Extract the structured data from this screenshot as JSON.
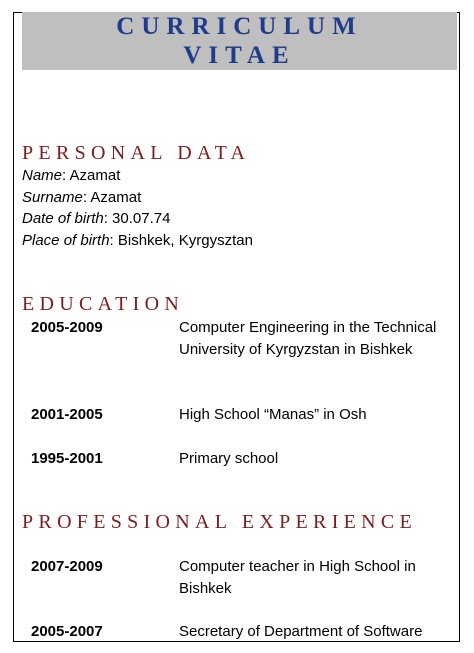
{
  "title": {
    "line1": "CURRICULUM",
    "line2": "VITAE"
  },
  "colors": {
    "title": "#1f3c8a",
    "section_heading": "#7b1d1d",
    "banner": "#bfbfbf"
  },
  "personal_data": {
    "heading": "PERSONAL DATA",
    "fields": [
      {
        "label": "Name",
        "value": ": Azamat"
      },
      {
        "label": "Surname",
        "value": ": Azamat"
      },
      {
        "label": "Date of birth",
        "value": ": 30.07.74"
      },
      {
        "label": "Place of birth",
        "value": ": Bishkek, Kyrgysztan"
      }
    ]
  },
  "education": {
    "heading": "EDUCATION",
    "entries": [
      {
        "years": "2005-2009",
        "description": "Computer Engineering in the Technical University of Kyrgyzstan in Bishkek"
      },
      {
        "years": "2001-2005",
        "description": "High School “Manas” in Osh"
      },
      {
        "years": "1995-2001",
        "description": "Primary school"
      }
    ]
  },
  "experience": {
    "heading": "PROFESSIONAL EXPERIENCE",
    "entries": [
      {
        "years": "2007-2009",
        "description": "Computer teacher in High School in Bishkek"
      },
      {
        "years": "2005-2007",
        "description": "Secretary of Department of Software"
      }
    ]
  }
}
